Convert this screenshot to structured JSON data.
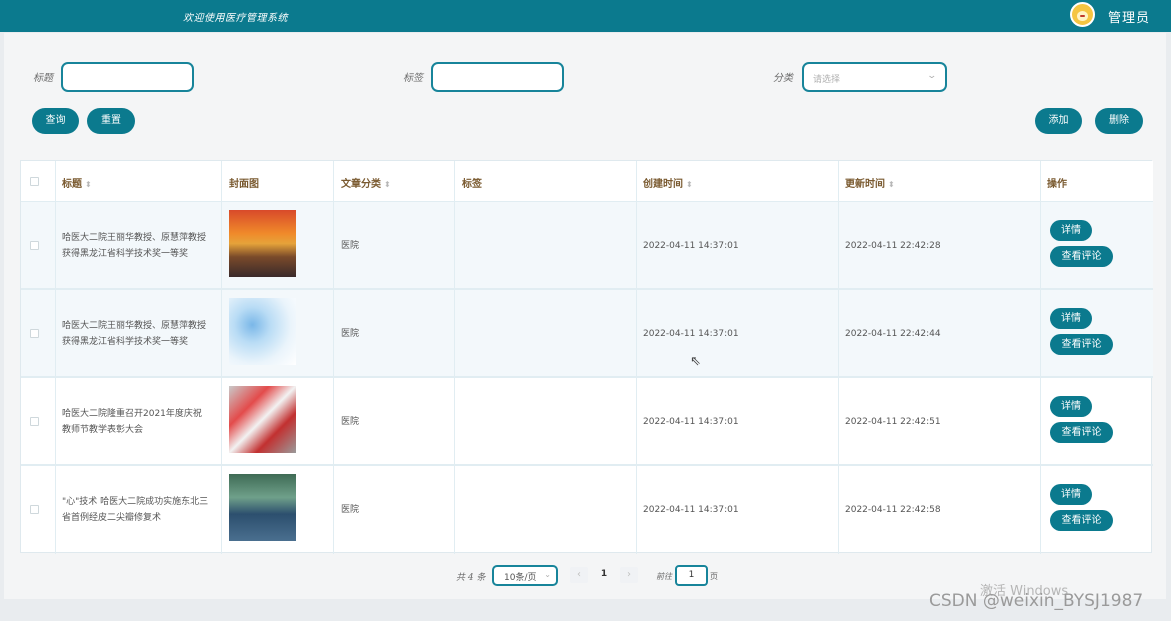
{
  "header": {
    "title": "欢迎使用医疗管理系统",
    "user_label": "管理员"
  },
  "search": {
    "title_label": "标题",
    "tag_label": "标签",
    "category_label": "分类",
    "category_placeholder": "请选择",
    "query_button": "查询",
    "reset_button": "重置",
    "add_button": "添加",
    "delete_button": "删除"
  },
  "table": {
    "columns": [
      "标题",
      "封面图",
      "文章分类",
      "标签",
      "创建时间",
      "更新时间",
      "操作"
    ],
    "detail_label": "详情",
    "comments_label": "查看评论",
    "rows": [
      {
        "title_line1": "哈医大二院王丽华教授、原慧萍教授",
        "title_line2": "获得黑龙江省科学技术奖一等奖",
        "category": "医院",
        "tags": "",
        "created": "2022-04-11 14:37:01",
        "updated": "2022-04-11 22:42:28"
      },
      {
        "title_line1": "哈医大二院王丽华教授、原慧萍教授",
        "title_line2": "获得黑龙江省科学技术奖一等奖",
        "category": "医院",
        "tags": "",
        "created": "2022-04-11 14:37:01",
        "updated": "2022-04-11 22:42:44"
      },
      {
        "title_line1": "哈医大二院隆重召开2021年度庆祝",
        "title_line2": "教师节教学表彰大会",
        "category": "医院",
        "tags": "",
        "created": "2022-04-11 14:37:01",
        "updated": "2022-04-11 22:42:51"
      },
      {
        "title_line1": "\"心\"技术 哈医大二院成功实施东北三",
        "title_line2": "省首例经皮二尖瓣修复术",
        "category": "医院",
        "tags": "",
        "created": "2022-04-11 14:37:01",
        "updated": "2022-04-11 22:42:58"
      }
    ]
  },
  "pagination": {
    "total": "共 4 条",
    "page_size": "10条/页",
    "current_page": "1",
    "goto_label": "前往",
    "goto_value": "1",
    "page_unit": "页"
  },
  "overlay": {
    "activate_windows": "激活 Windows",
    "csdn": "CSDN @weixin_BYSJ1987"
  },
  "colors": {
    "primary": "#0b7a8e",
    "background": "#f4f5f6"
  }
}
